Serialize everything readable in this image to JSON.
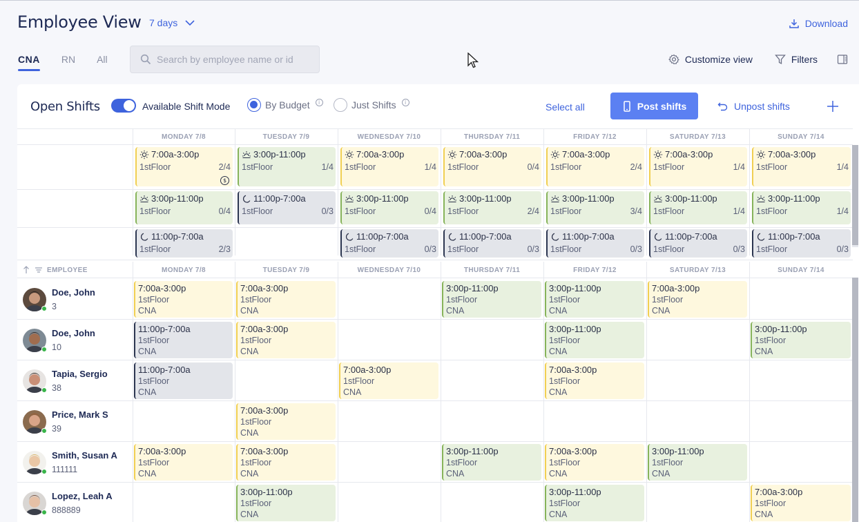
{
  "header": {
    "title": "Employee View",
    "range_label": "7 days",
    "download_label": "Download"
  },
  "role_tabs": [
    {
      "label": "CNA",
      "active": true
    },
    {
      "label": "RN",
      "active": false
    },
    {
      "label": "All",
      "active": false
    }
  ],
  "search": {
    "placeholder": "Search by employee name or id",
    "value": ""
  },
  "toolbar": {
    "customize_label": "Customize view",
    "filters_label": "Filters"
  },
  "open_shifts": {
    "title": "Open Shifts",
    "available_mode_label": "Available Shift Mode",
    "available_mode_on": true,
    "radio_by_budget": "By Budget",
    "radio_just_shifts": "Just Shifts",
    "selected_radio": "By Budget",
    "select_all_label": "Select all",
    "post_label": "Post shifts",
    "unpost_label": "Unpost shifts"
  },
  "days": [
    "MONDAY 7/8",
    "TUESDAY 7/9",
    "WEDNESDAY 7/10",
    "THURSDAY 7/11",
    "FRIDAY 7/12",
    "SATURDAY 7/13",
    "SUNDAY 7/14"
  ],
  "open_shift_rows": [
    [
      {
        "type": "day",
        "time": "7:00a-3:00p",
        "loc": "1stFloor",
        "ratio": "2/4",
        "coin": "$"
      },
      {
        "type": "eve",
        "time": "3:00p-11:00p",
        "loc": "1stFloor",
        "ratio": "1/4"
      },
      {
        "type": "day",
        "time": "7:00a-3:00p",
        "loc": "1stFloor",
        "ratio": "1/4"
      },
      {
        "type": "day",
        "time": "7:00a-3:00p",
        "loc": "1stFloor",
        "ratio": "0/4"
      },
      {
        "type": "day",
        "time": "7:00a-3:00p",
        "loc": "1stFloor",
        "ratio": "2/4"
      },
      {
        "type": "day",
        "time": "7:00a-3:00p",
        "loc": "1stFloor",
        "ratio": "1/4"
      },
      {
        "type": "day",
        "time": "7:00a-3:00p",
        "loc": "1stFloor",
        "ratio": "1/4"
      }
    ],
    [
      {
        "type": "eve",
        "time": "3:00p-11:00p",
        "loc": "1stFloor",
        "ratio": "0/4"
      },
      {
        "type": "night",
        "time": "11:00p-7:00a",
        "loc": "1stFloor",
        "ratio": "0/3"
      },
      {
        "type": "eve",
        "time": "3:00p-11:00p",
        "loc": "1stFloor",
        "ratio": "0/4"
      },
      {
        "type": "eve",
        "time": "3:00p-11:00p",
        "loc": "1stFloor",
        "ratio": "2/4"
      },
      {
        "type": "eve",
        "time": "3:00p-11:00p",
        "loc": "1stFloor",
        "ratio": "3/4"
      },
      {
        "type": "eve",
        "time": "3:00p-11:00p",
        "loc": "1stFloor",
        "ratio": "1/4"
      },
      {
        "type": "eve",
        "time": "3:00p-11:00p",
        "loc": "1stFloor",
        "ratio": "1/4"
      }
    ],
    [
      {
        "type": "night",
        "time": "11:00p-7:00a",
        "loc": "1stFloor",
        "ratio": "2/3"
      },
      null,
      {
        "type": "night",
        "time": "11:00p-7:00a",
        "loc": "1stFloor",
        "ratio": "0/3"
      },
      {
        "type": "night",
        "time": "11:00p-7:00a",
        "loc": "1stFloor",
        "ratio": "0/3"
      },
      {
        "type": "night",
        "time": "11:00p-7:00a",
        "loc": "1stFloor",
        "ratio": "0/3"
      },
      {
        "type": "night",
        "time": "11:00p-7:00a",
        "loc": "1stFloor",
        "ratio": "0/3"
      },
      {
        "type": "night",
        "time": "11:00p-7:00a",
        "loc": "1stFloor",
        "ratio": "0/3"
      }
    ]
  ],
  "employee_header": "EMPLOYEE",
  "employees": [
    {
      "name": "Doe, John",
      "id": "3",
      "avatar": "avatar-man-dark-hair",
      "shifts": [
        {
          "type": "day",
          "time": "7:00a-3:00p",
          "loc": "1stFloor",
          "role": "CNA"
        },
        {
          "type": "day",
          "time": "7:00a-3:00p",
          "loc": "1stFloor",
          "role": "CNA"
        },
        null,
        {
          "type": "eve",
          "time": "3:00p-11:00p",
          "loc": "1stFloor",
          "role": "CNA"
        },
        {
          "type": "eve",
          "time": "3:00p-11:00p",
          "loc": "1stFloor",
          "role": "CNA"
        },
        {
          "type": "day",
          "time": "7:00a-3:00p",
          "loc": "1stFloor",
          "role": "CNA"
        },
        null
      ]
    },
    {
      "name": "Doe, John",
      "id": "10",
      "avatar": "avatar-man-bald",
      "shifts": [
        {
          "type": "night",
          "time": "11:00p-7:00a",
          "loc": "1stFloor",
          "role": "CNA"
        },
        {
          "type": "day",
          "time": "7:00a-3:00p",
          "loc": "1stFloor",
          "role": "CNA"
        },
        null,
        null,
        {
          "type": "eve",
          "time": "3:00p-11:00p",
          "loc": "1stFloor",
          "role": "CNA"
        },
        null,
        {
          "type": "eve",
          "time": "3:00p-11:00p",
          "loc": "1stFloor",
          "role": "CNA"
        }
      ]
    },
    {
      "name": "Tapia, Sergio",
      "id": "38",
      "avatar": "avatar-man-beard",
      "shifts": [
        {
          "type": "night",
          "time": "11:00p-7:00a",
          "loc": "1stFloor",
          "role": "CNA"
        },
        null,
        {
          "type": "day",
          "time": "7:00a-3:00p",
          "loc": "1stFloor",
          "role": "CNA"
        },
        null,
        {
          "type": "day",
          "time": "7:00a-3:00p",
          "loc": "1stFloor",
          "role": "CNA"
        },
        null,
        null
      ]
    },
    {
      "name": "Price, Mark S",
      "id": "39",
      "avatar": "avatar-man-ginger",
      "shifts": [
        null,
        {
          "type": "day",
          "time": "7:00a-3:00p",
          "loc": "1stFloor",
          "role": "CNA"
        },
        null,
        null,
        null,
        null,
        null
      ]
    },
    {
      "name": "Smith, Susan A",
      "id": "111111",
      "avatar": "avatar-woman-blonde",
      "shifts": [
        {
          "type": "day",
          "time": "7:00a-3:00p",
          "loc": "1stFloor",
          "role": "CNA"
        },
        {
          "type": "day",
          "time": "7:00a-3:00p",
          "loc": "1stFloor",
          "role": "CNA"
        },
        null,
        {
          "type": "eve",
          "time": "3:00p-11:00p",
          "loc": "1stFloor",
          "role": "CNA"
        },
        {
          "type": "day",
          "time": "7:00a-3:00p",
          "loc": "1stFloor",
          "role": "CNA"
        },
        {
          "type": "eve",
          "time": "3:00p-11:00p",
          "loc": "1stFloor",
          "role": "CNA"
        },
        null
      ]
    },
    {
      "name": "Lopez, Leah A",
      "id": "888889",
      "avatar": "avatar-woman-brown",
      "shifts": [
        null,
        {
          "type": "eve",
          "time": "3:00p-11:00p",
          "loc": "1stFloor",
          "role": "CNA"
        },
        null,
        null,
        {
          "type": "eve",
          "time": "3:00p-11:00p",
          "loc": "1stFloor",
          "role": "CNA"
        },
        null,
        {
          "type": "day",
          "time": "7:00a-3:00p",
          "loc": "1stFloor",
          "role": "CNA"
        }
      ]
    }
  ],
  "colors": {
    "accent": "#3e63dd",
    "day_shift": "#fef8de",
    "evening_shift": "#e8f1df",
    "night_shift": "#e3e5ea"
  }
}
